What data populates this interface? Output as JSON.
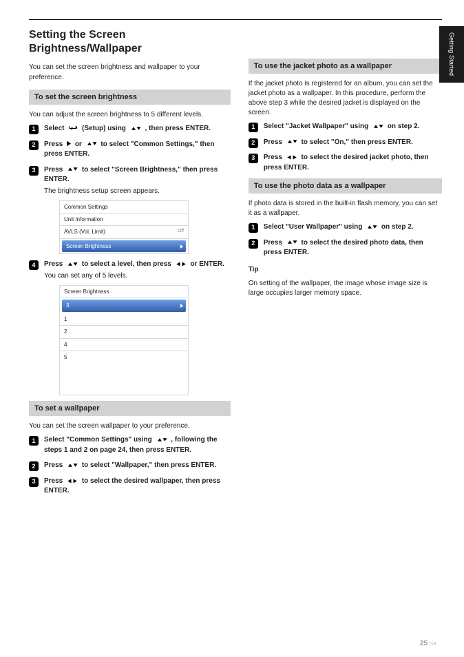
{
  "sideTab": "Getting Started",
  "pageNumber": "25",
  "pageNumberSuffix": "GB",
  "left": {
    "title": "Setting the Screen Brightness/Wallpaper",
    "intro": "You can set the screen brightness and wallpaper to your preference.",
    "section1": {
      "heading": "To set the screen brightness",
      "intro": "You can adjust the screen brightness to 5 different levels.",
      "steps": [
        {
          "main_pre": "Select ",
          "insert_icon": "wrench",
          "main_post": " (Setup) using ",
          "arrows": "ud",
          "main_end": ", then press ENTER."
        },
        {
          "main_pre": "Press ",
          "insert_triangle": true,
          "main_mid": " or ",
          "arrows": "ud",
          "main_post": " to select \"Common Settings,\" then press ENTER."
        },
        {
          "main_pre": "Press ",
          "arrows": "ud",
          "main_post": " to select \"Screen Brightness,\" then press ENTER.",
          "sub": "The brightness setup screen appears."
        },
        {
          "main_pre": "Press ",
          "arrows": "ud",
          "main_post": " to select a level, then press ",
          "arrows2": "lr",
          "main_end": " or ENTER.",
          "sub": "You can set any of 5 levels."
        }
      ],
      "panel1": {
        "title": "Common Settings",
        "row1": "Unit Information",
        "row2_label": "AVLS (Vol. Limit)",
        "row2_value": "Off",
        "row3": "Screen Brightness"
      },
      "panel2": {
        "title": "Screen Brightness",
        "sel": "3",
        "rows": [
          "1",
          "2",
          "4",
          "5"
        ]
      }
    },
    "section2": {
      "heading": "To set a wallpaper",
      "intro": "You can set the screen wallpaper to your preference.",
      "steps": [
        {
          "main_pre": "Select \"Common Settings\" using ",
          "arrows": "ud",
          "main_post": ", following the steps 1 and 2 on page 24, then press ENTER."
        },
        {
          "main_pre": "Press ",
          "arrows": "ud",
          "main_post": " to select \"Wallpaper,\" then press ENTER."
        },
        {
          "main_pre": "Press ",
          "arrows": "lr",
          "main_post": " to select the desired wallpaper, then press ENTER."
        }
      ]
    }
  },
  "right": {
    "section1": {
      "heading": "To use the jacket photo as a wallpaper",
      "intro": "If the jacket photo is registered for an album, you can set the jacket photo as a wallpaper. In this procedure, perform the above step 3 while the desired jacket is displayed on the screen.",
      "steps": [
        {
          "main_pre": "Select \"Jacket Wallpaper\" using ",
          "arrows": "ud",
          "main_post": " on step 2."
        },
        {
          "main_pre": "Press ",
          "arrows": "ud",
          "main_post": " to select \"On,\" then press ENTER."
        },
        {
          "main_pre": "Press ",
          "arrows": "lr",
          "main_post": " to select the desired jacket photo, then press ENTER."
        }
      ]
    },
    "section2": {
      "heading": "To use the photo data as a wallpaper",
      "intro": "If photo data is stored in the built-in flash memory, you can set it as a wallpaper.",
      "steps": [
        {
          "main_pre": "Select \"User Wallpaper\" using ",
          "arrows": "ud",
          "main_post": " on step 2."
        },
        {
          "main_pre": "Press ",
          "arrows": "ud",
          "main_post": " to select the desired photo data, then press ENTER."
        }
      ],
      "tip_label": "Tip",
      "tip_text": "On setting of the wallpaper, the image whose image size is large occupies larger memory space."
    }
  }
}
